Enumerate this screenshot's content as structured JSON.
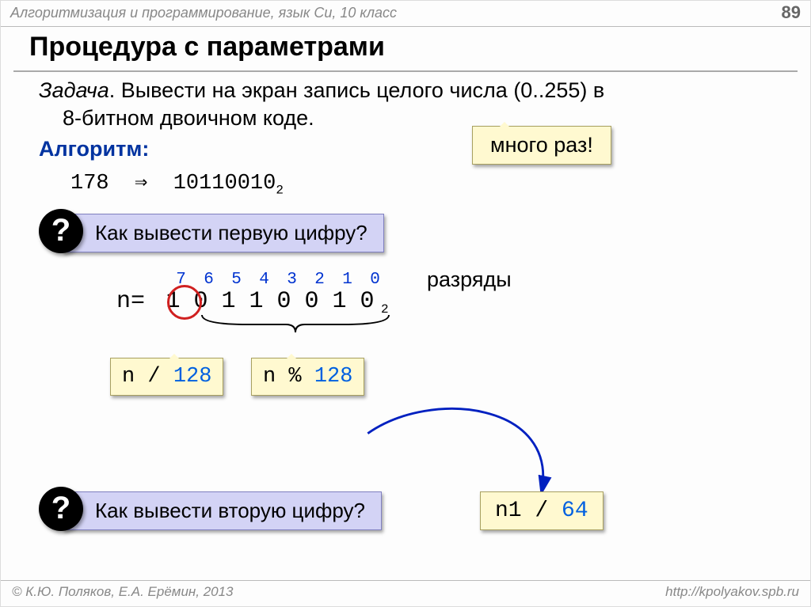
{
  "header": {
    "course": "Алгоритмизация и программирование, язык Си, 10 класс",
    "page": "89"
  },
  "title": "Процедура с параметрами",
  "task": {
    "label": "Задача",
    "text": ". Вывести на экран запись целого числа (0..255) в",
    "text2": "8-битном двоичном коде."
  },
  "callout_many": "много раз!",
  "algo_label": "Алгоритм:",
  "conversion": {
    "src": "178",
    "arrow": "⇒",
    "bin": "10110010",
    "sub": "2"
  },
  "q1": {
    "mark": "?",
    "text": "Как вывести первую цифру?"
  },
  "diagram": {
    "bits_label": "разряды",
    "bit_indices": [
      "7",
      "6",
      "5",
      "4",
      "3",
      "2",
      "1",
      "0"
    ],
    "n_prefix": "n=",
    "bits": [
      "1",
      "0",
      "1",
      "1",
      "0",
      "0",
      "1",
      "0"
    ],
    "sub": "2",
    "box1_a": "n / ",
    "box1_b": "128",
    "box2_a": "n % ",
    "box2_b": "128"
  },
  "q2": {
    "mark": "?",
    "text": "Как вывести вторую цифру?"
  },
  "answer": {
    "a": "n1 / ",
    "b": "64"
  },
  "footer": {
    "left": "© К.Ю. Поляков, Е.А. Ерёмин, 2013",
    "right": "http://kpolyakov.spb.ru"
  }
}
